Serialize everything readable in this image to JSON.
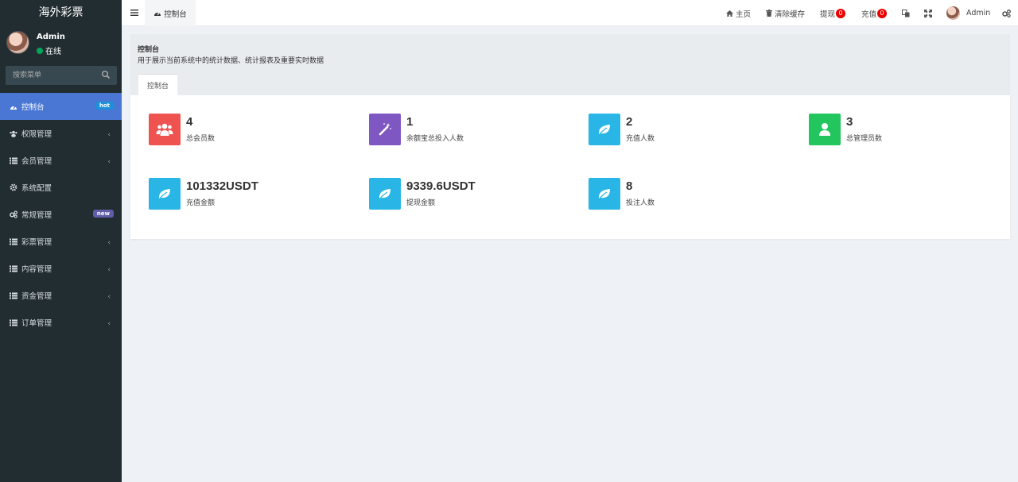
{
  "brand": "海外彩票",
  "user": {
    "name": "Admin",
    "status": "在线"
  },
  "search": {
    "placeholder": "搜索菜单"
  },
  "menu": [
    {
      "label": "控制台",
      "icon": "dashboard-icon",
      "badge": "hot",
      "active": true
    },
    {
      "label": "权限管理",
      "icon": "users-icon",
      "chevron": "‹"
    },
    {
      "label": "会员管理",
      "icon": "list-icon",
      "chevron": "‹"
    },
    {
      "label": "系统配置",
      "icon": "gear-icon"
    },
    {
      "label": "常规管理",
      "icon": "gears-icon",
      "badge": "new"
    },
    {
      "label": "彩票管理",
      "icon": "list-icon",
      "chevron": "‹"
    },
    {
      "label": "内容管理",
      "icon": "list-icon",
      "chevron": "‹"
    },
    {
      "label": "资金管理",
      "icon": "list-icon",
      "chevron": "‹"
    },
    {
      "label": "订单管理",
      "icon": "list-icon",
      "chevron": "‹"
    }
  ],
  "topbar": {
    "tab": "控制台",
    "home": "主页",
    "clear_cache": "清除缓存",
    "withdraw": "提现",
    "withdraw_count": "0",
    "recharge": "充值",
    "recharge_count": "0",
    "user": "Admin"
  },
  "header": {
    "title": "控制台",
    "desc": "用于展示当前系统中的统计数据、统计报表及重要实时数据",
    "tab": "控制台"
  },
  "stats": [
    {
      "value": "4",
      "label": "总会员数",
      "color": "#ef5350",
      "icon": "users-icon"
    },
    {
      "value": "1",
      "label": "余额宝总投入人数",
      "color": "#7e57c2",
      "icon": "magic-icon"
    },
    {
      "value": "2",
      "label": "充值人数",
      "color": "#29b6e6",
      "icon": "leaf-icon"
    },
    {
      "value": "3",
      "label": "总管理员数",
      "color": "#22c55e",
      "icon": "user-icon"
    },
    {
      "value": "101332USDT",
      "label": "充值金额",
      "color": "#29b6e6",
      "icon": "leaf-icon"
    },
    {
      "value": "9339.6USDT",
      "label": "提现金额",
      "color": "#29b6e6",
      "icon": "leaf-icon"
    },
    {
      "value": "8",
      "label": "投注人数",
      "color": "#29b6e6",
      "icon": "leaf-icon"
    }
  ],
  "colors": {
    "sidebar": "#222d32",
    "active": "#4a77d4",
    "badge_hot": "#1e90d8",
    "badge_new": "#605ca8"
  }
}
